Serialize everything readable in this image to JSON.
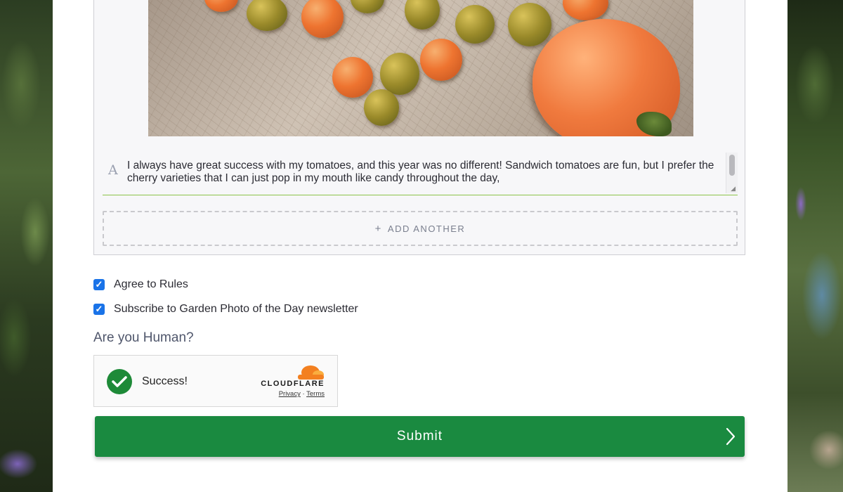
{
  "caption": {
    "text": "I always have great success with my tomatoes, and this year was no different! Sandwich tomatoes are fun, but I prefer the cherry varieties that I can just pop in my mouth like candy throughout the day,",
    "format_icon": "A"
  },
  "add_another": {
    "icon": "+",
    "label": "ADD ANOTHER"
  },
  "checkboxes": [
    {
      "label": "Agree to Rules",
      "checked": true
    },
    {
      "label": "Subscribe to Garden Photo of the Day newsletter",
      "checked": true
    }
  ],
  "human_check": {
    "question": "Are you Human?",
    "status": "Success!",
    "provider": "CLOUDFLARE",
    "privacy_link": "Privacy",
    "separator": "·",
    "terms_link": "Terms"
  },
  "submit": {
    "label": "Submit"
  },
  "colors": {
    "submit_bg": "#1a8a40",
    "checkbox": "#1a73e8",
    "success": "#1e8a38",
    "caption_underline": "#8bc34a",
    "cloudflare_orange": "#f38020"
  }
}
